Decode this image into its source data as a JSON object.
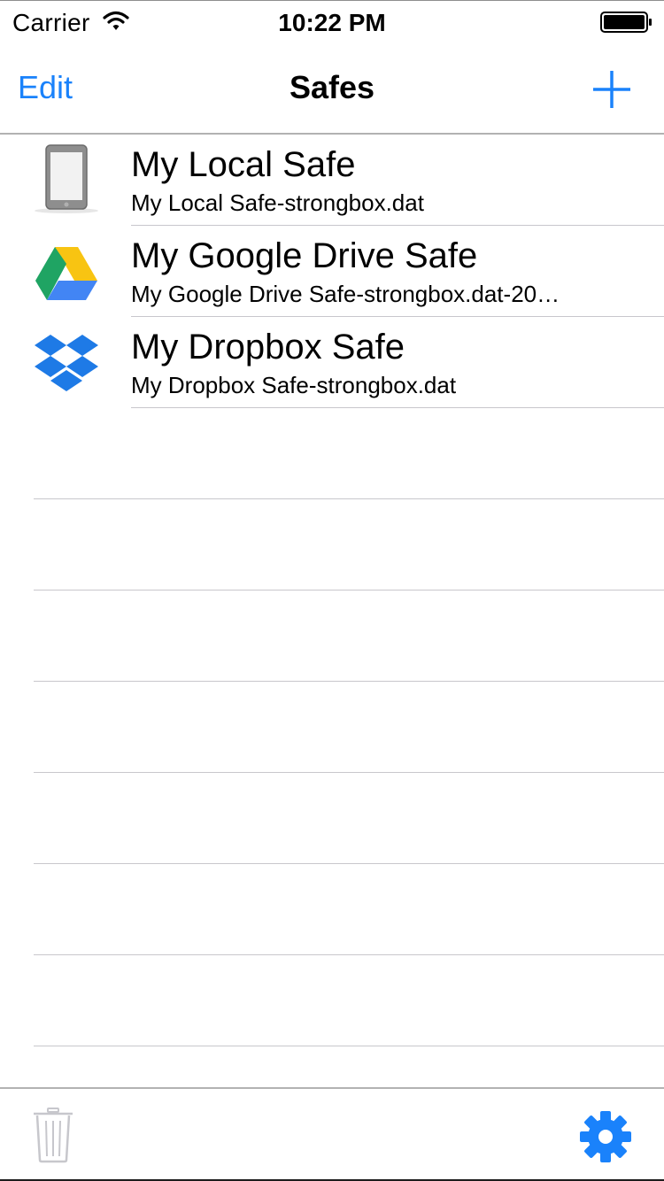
{
  "status_bar": {
    "carrier": "Carrier",
    "time": "10:22 PM",
    "icons": [
      "wifi-icon",
      "battery-icon"
    ]
  },
  "nav": {
    "edit_label": "Edit",
    "title": "Safes",
    "add_icon": "plus-icon"
  },
  "safes": [
    {
      "title": "My Local Safe",
      "subtitle": "My Local Safe-strongbox.dat",
      "icon": "device-icon"
    },
    {
      "title": "My Google Drive Safe",
      "subtitle": "My Google Drive Safe-strongbox.dat-20…",
      "icon": "google-drive-icon"
    },
    {
      "title": "My Dropbox Safe",
      "subtitle": "My Dropbox Safe-strongbox.dat",
      "icon": "dropbox-icon"
    }
  ],
  "toolbar": {
    "trash_icon": "trash-icon",
    "settings_icon": "gear-icon"
  },
  "colors": {
    "accent": "#1a82fb",
    "separator": "#c8c7cc",
    "disabled": "#c7c7cc"
  }
}
